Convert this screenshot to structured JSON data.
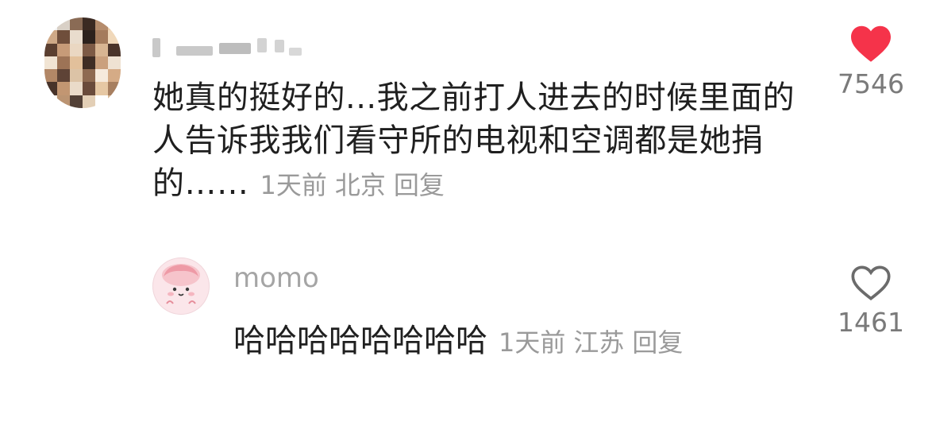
{
  "comment": {
    "text": "她真的挺好的...我之前打人进去的时候里面的人告诉我我们看守所的电视和空调都是她捐的……",
    "time": "1天前",
    "location": "北京",
    "reply_label": "回复",
    "likes": "7546",
    "liked": true,
    "heart_color": "#f5334a"
  },
  "reply": {
    "username": "momo",
    "text": "哈哈哈哈哈哈哈哈",
    "time": "1天前",
    "location": "江苏",
    "reply_label": "回复",
    "likes": "1461",
    "liked": false
  }
}
